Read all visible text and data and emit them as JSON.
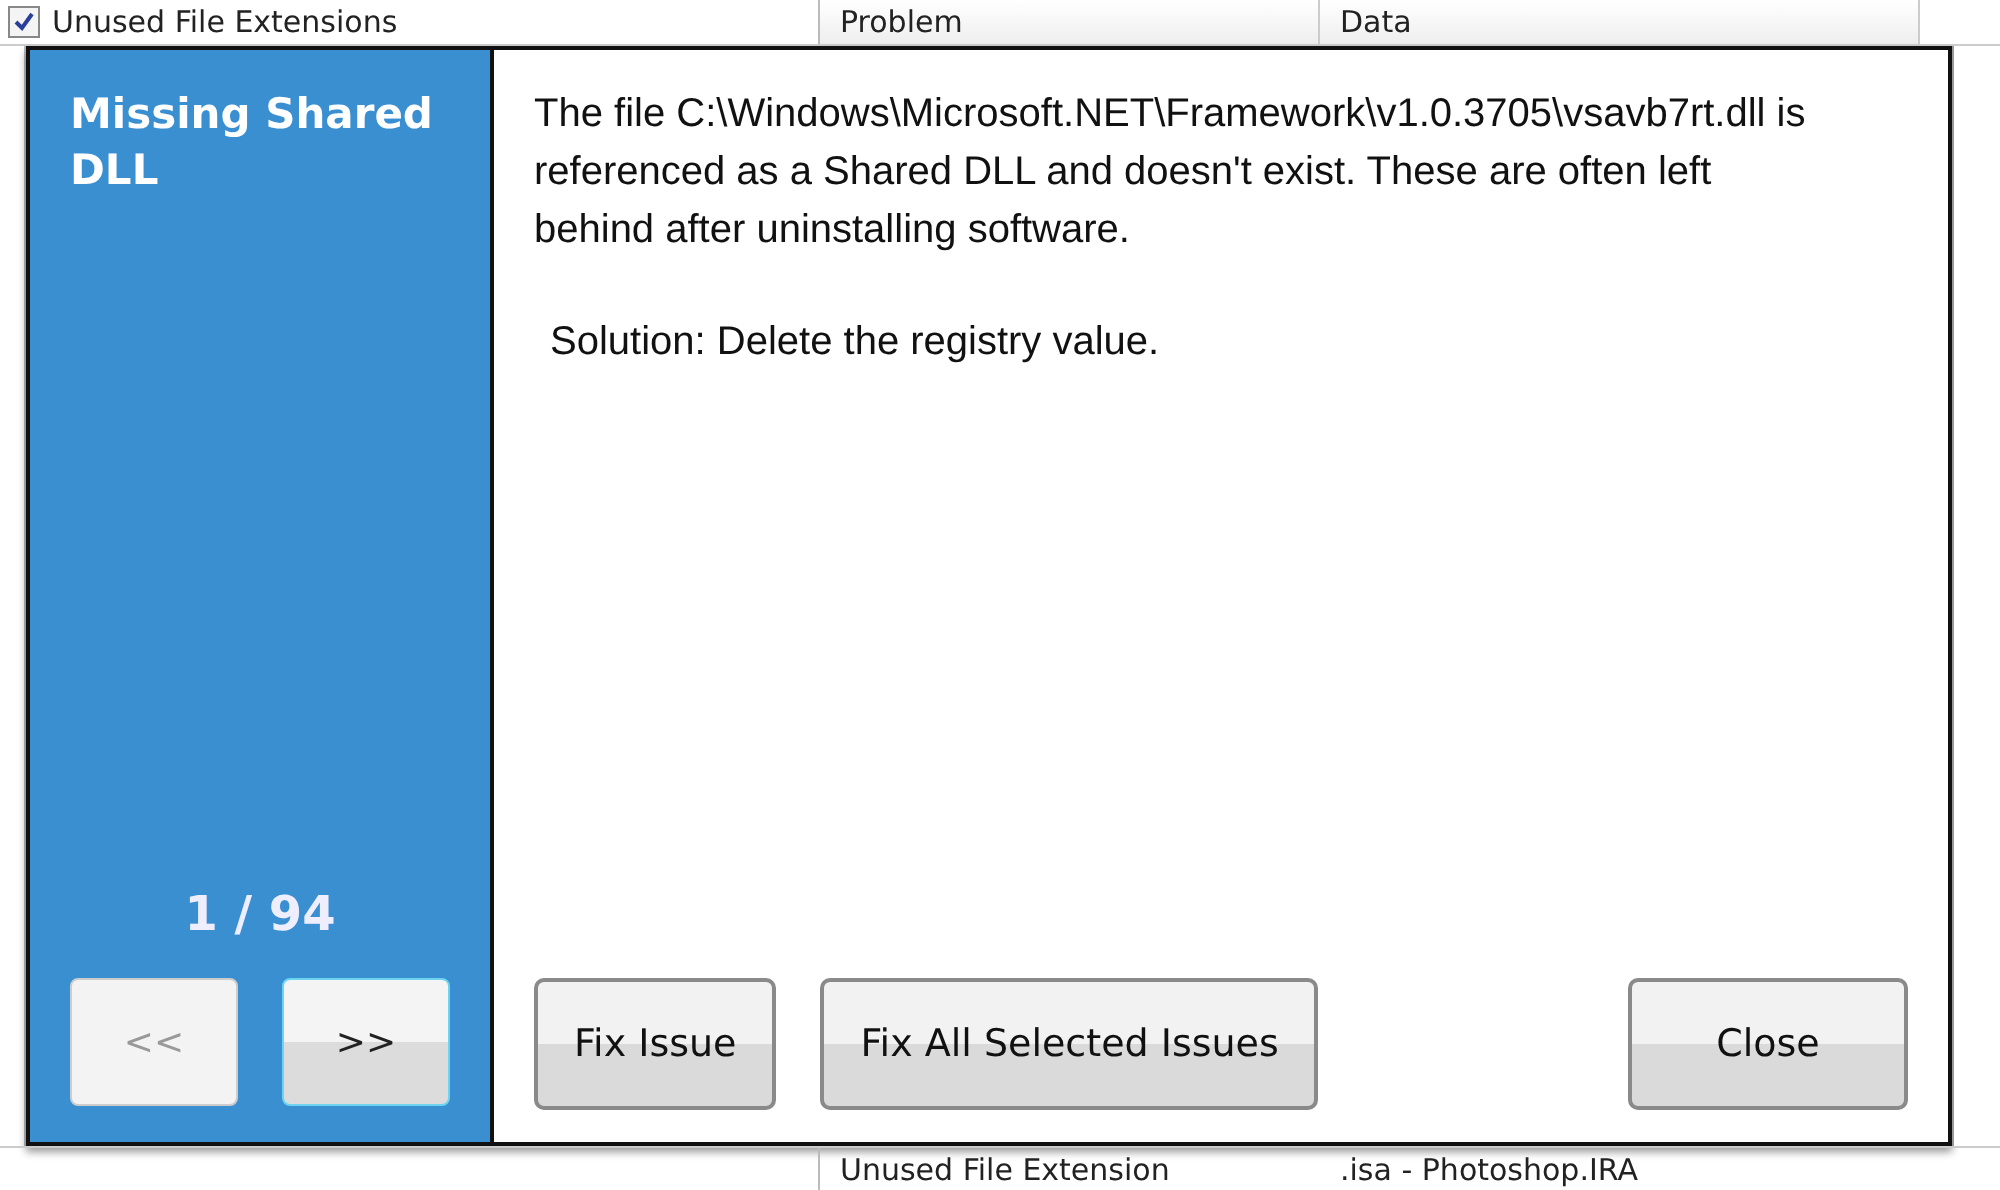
{
  "background": {
    "list_items": [
      {
        "label": "Unused File Extensions",
        "checked": true
      }
    ],
    "columns": [
      "Problem",
      "Data"
    ],
    "rows": [
      {
        "problem": "Unused File Extension",
        "data": ".isa - Photoshop.IRA"
      }
    ]
  },
  "dialog": {
    "title": "Missing Shared DLL",
    "message": "The file C:\\Windows\\Microsoft.NET\\Framework\\v1.0.3705\\vsavb7rt.dll is referenced as a Shared DLL and doesn't exist. These are often left behind after uninstalling software.",
    "solution": "Solution: Delete the registry value.",
    "counter": "1 / 94",
    "nav_buttons": [
      {
        "label": "<<",
        "disabled": true
      },
      {
        "label": ">>",
        "disabled": false
      }
    ],
    "buttons": [
      "Fix Issue",
      "Fix All Selected Issues",
      "Close"
    ]
  }
}
